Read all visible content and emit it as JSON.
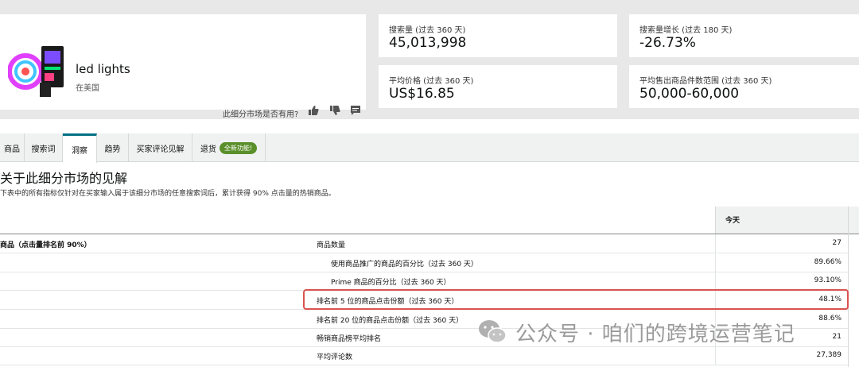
{
  "product": {
    "title": "led lights",
    "subtitle": "在美国",
    "feedback_question": "此细分市场是否有用?"
  },
  "metrics": [
    {
      "label": "搜索量 (过去 360 天)",
      "value": "45,013,998"
    },
    {
      "label": "搜索量增长 (过去 180 天)",
      "value": "-26.73%"
    },
    {
      "label": "平均价格 (过去 360 天)",
      "value": "US$16.85"
    },
    {
      "label": "平均售出商品件数范围 (过去 360 天)",
      "value": "50,000-60,000"
    }
  ],
  "tabs": [
    {
      "label": "商品"
    },
    {
      "label": "搜索词"
    },
    {
      "label": "洞察",
      "active": true
    },
    {
      "label": "趋势"
    },
    {
      "label": "买家评论见解"
    },
    {
      "label": "退货",
      "badge": "全新功能!"
    }
  ],
  "insights": {
    "title": "关于此细分市场的见解",
    "description": "下表中的所有指标仅针对在买家输入属于该细分市场的任意搜索词后，累计获得 90% 点击量的热销商品。",
    "column_header": "今天",
    "group_label": "商品（点击量排名前 90%）",
    "rows": [
      {
        "name": "商品数量",
        "value": "27"
      },
      {
        "name": "使用商品推广的商品的百分比（过去 360 天）",
        "value": "89.66%"
      },
      {
        "name": "Prime 商品的百分比（过去 360 天）",
        "value": "93.10%"
      },
      {
        "name": "排名前 5 位的商品点击份额（过去 360 天）",
        "value": "48.1%"
      },
      {
        "name": "排名前 20 位的商品点击份额（过去 360 天）",
        "value": "88.6%"
      },
      {
        "name": "畅销商品榜平均排名",
        "value": "21"
      },
      {
        "name": "平均评论数",
        "value": "27,389"
      }
    ]
  },
  "watermark": {
    "text": "公众号 · 咱们的跨境运营笔记"
  },
  "colors": {
    "accent_tab": "#007185",
    "badge_green": "#5a8f2a",
    "highlight_red": "#d9534f"
  },
  "icons": [
    "thumbs-up-icon",
    "thumbs-down-icon",
    "comment-icon",
    "wechat-icon"
  ]
}
